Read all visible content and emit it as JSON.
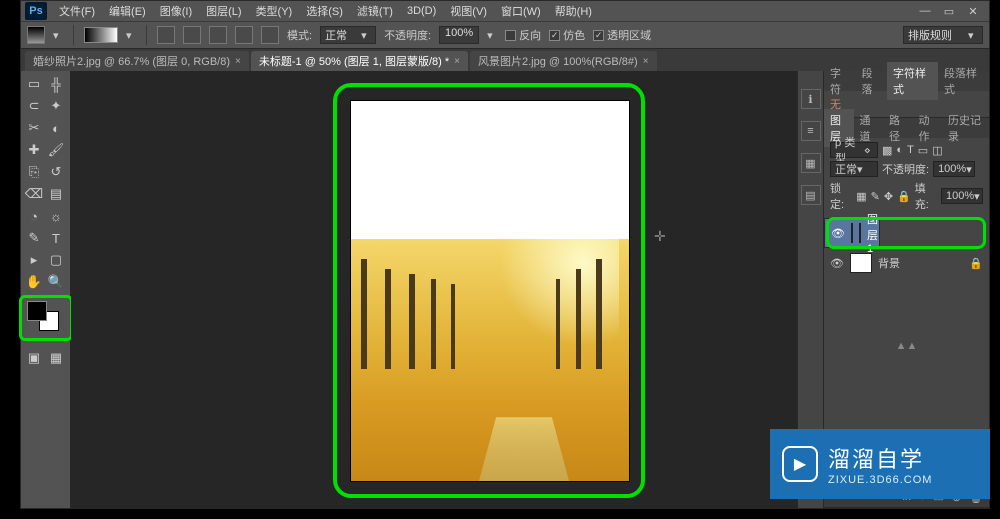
{
  "menubar": {
    "logo": "Ps",
    "items": [
      "文件(F)",
      "编辑(E)",
      "图像(I)",
      "图层(L)",
      "类型(Y)",
      "选择(S)",
      "滤镜(T)",
      "3D(D)",
      "视图(V)",
      "窗口(W)",
      "帮助(H)"
    ]
  },
  "options": {
    "mode_label": "模式:",
    "mode_value": "正常",
    "opacity_label": "不透明度:",
    "opacity_value": "100%",
    "flip": "反向",
    "dither": "仿色",
    "transparency": "透明区域",
    "right_combo": "排版规则"
  },
  "tabs": [
    {
      "label": "婚纱照片2.jpg @ 66.7% (图层 0, RGB/8)",
      "active": false
    },
    {
      "label": "未标题-1 @ 50% (图层 1, 图层蒙版/8) *",
      "active": true
    },
    {
      "label": "风景图片2.jpg @ 100%(RGB/8#)",
      "active": false
    }
  ],
  "tools": {
    "names": [
      "move",
      "marquee",
      "lasso",
      "magic-wand",
      "crop",
      "eyedropper",
      "healing",
      "brush",
      "stamp",
      "history-brush",
      "eraser",
      "gradient",
      "blur",
      "dodge",
      "pen",
      "type",
      "path-select",
      "rectangle",
      "hand",
      "zoom"
    ],
    "glyphs": [
      "╬",
      "▭",
      "⊂",
      "✦",
      "✂",
      "◐",
      "✚",
      "🖌",
      "⎘",
      "↺",
      "⌫",
      "▤",
      "◔",
      "☼",
      "✎",
      "T",
      "▸",
      "▢",
      "✋",
      "🔍"
    ]
  },
  "dock": {
    "names": [
      "info",
      "ruler",
      "swatches",
      "styles"
    ],
    "glyphs": [
      "ℹ",
      "≡",
      "▦",
      "▤"
    ]
  },
  "panels": {
    "char": {
      "tabs": [
        "字符",
        "段落",
        "字符样式",
        "段落样式"
      ],
      "active_idx": 2,
      "body": "无"
    },
    "layers": {
      "tabs": [
        "图层",
        "通道",
        "路径",
        "动作",
        "历史记录"
      ],
      "active_idx": 0,
      "kind_label": "ρ 类型",
      "blend_mode": "正常",
      "opacity_label": "不透明度:",
      "opacity_value": "100%",
      "lock_label": "锁定:",
      "fill_label": "填充:",
      "fill_value": "100%",
      "rows": [
        {
          "name": "图层 1",
          "has_mask": true,
          "selected": true,
          "locked": false
        },
        {
          "name": "背景",
          "has_mask": false,
          "selected": false,
          "locked": true
        }
      ],
      "bottom_glyphs": [
        "fx",
        "◑",
        "▭",
        "⊕",
        "🗑"
      ]
    }
  },
  "watermark": {
    "title": "溜溜自学",
    "sub": "ZIXUE.3D66.COM"
  }
}
